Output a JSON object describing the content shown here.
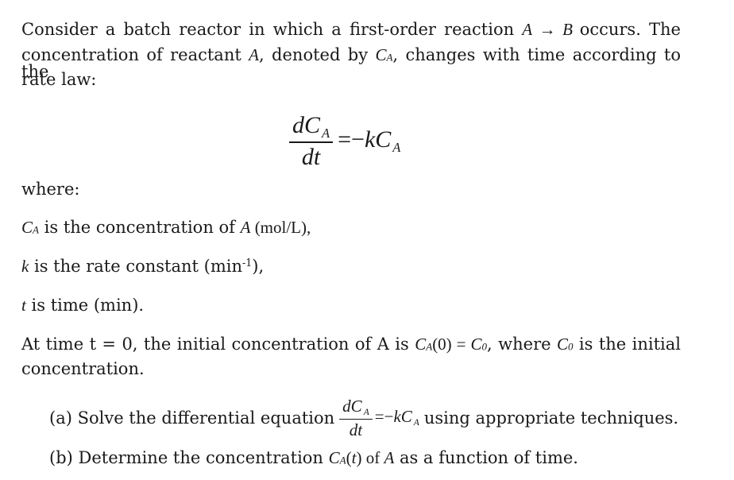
{
  "intro": {
    "line1": {
      "before": "Consider a batch reactor in which a first-order reaction",
      "reaction_lhs": "A",
      "arrow": "→",
      "reaction_rhs": "B",
      "after": "occurs. The"
    },
    "line2": {
      "t1": "concentration of reactant ",
      "var_a": "A",
      "t2": ", denoted by ",
      "var_c": "C",
      "var_c_sub": "A",
      "t3": ", changes with time according to the"
    },
    "line3": "rate law:"
  },
  "equation": {
    "num_d": "d",
    "num_c": "C",
    "num_sub": "A",
    "den": "dt",
    "equals": "=",
    "minus": "−",
    "k": "k",
    "rhs_c": "C",
    "rhs_sub": "A"
  },
  "where_label": "where:",
  "definitions": [
    {
      "var": "C",
      "var_sub": "A",
      "text": " is the concentration of ",
      "var2": "A",
      "text2": " (mol/L),"
    },
    {
      "var": "k",
      "text": " is the rate constant (min",
      "sup": "-1",
      "text2": "),"
    },
    {
      "var": "t",
      "text": " is time (min)."
    }
  ],
  "initial": {
    "line1": {
      "t1": "At time t = 0, the initial concentration of A is ",
      "c": "C",
      "c_sub": "A",
      "t2": "(0) = ",
      "c0": "C",
      "c0_sub": "0",
      "t3": ", where ",
      "c0b": "C",
      "c0b_sub": "0",
      "t4": " is the initial"
    },
    "line2": "concentration."
  },
  "parts": {
    "a": {
      "label": "(a) Solve the differential equation",
      "after": "using appropriate techniques."
    },
    "b": {
      "t1": "(b) Determine the concentration ",
      "c": "C",
      "c_sub": "A",
      "t2": "(",
      "t_var": "t",
      "t3": ") of ",
      "a_var": "A",
      "t4": " as a function of time."
    }
  }
}
